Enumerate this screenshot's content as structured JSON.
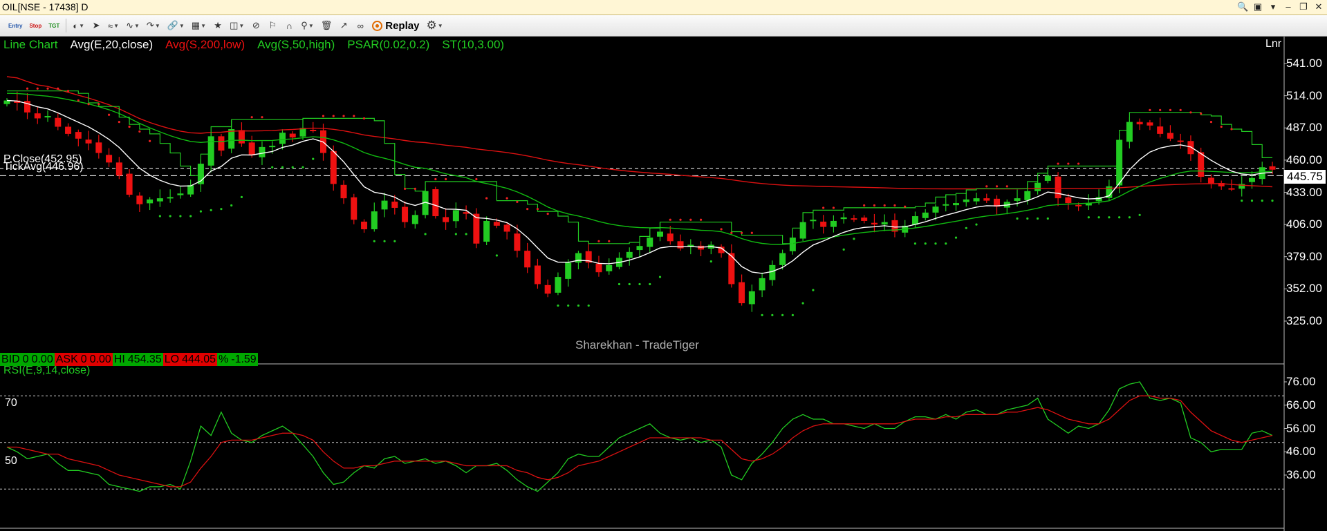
{
  "window": {
    "title": "OIL[NSE - 17438] D"
  },
  "toolbar": {
    "entry_label": "Entry",
    "stop_label": "Stop",
    "tgt_label": "TGT",
    "replay_label": "Replay"
  },
  "legend": {
    "chart_type": "Line Chart",
    "ema20": "Avg(E,20,close)",
    "sma200": "Avg(S,200,low)",
    "sma50": "Avg(S,50,high)",
    "psar": "PSAR(0.02,0.2)",
    "supertrend": "ST(10,3.00)",
    "scale_mode": "Lnr"
  },
  "colors": {
    "background": "#000000",
    "up_candle": "#22cc22",
    "down_candle": "#ee1111",
    "ema": "#ffffff",
    "sma200": "#dd1111",
    "sma50": "#11bb11",
    "psar": "#ee2222",
    "rsi": "#22cc22",
    "rsi_signal": "#dd1111"
  },
  "watermark": "Sharekhan - TradeTiger",
  "price_labels": {
    "prev_close": "P.Close(452.95)",
    "tick_avg": "TickAvg(446.96)",
    "current_price": "445.75"
  },
  "quote_bar": {
    "bid_label": "BID",
    "bid_qty": "0",
    "bid_price": "0.00",
    "ask_label": "ASK",
    "ask_qty": "0",
    "ask_price": "0.00",
    "hi_label": "HI",
    "hi_value": "454.35",
    "lo_label": "LO",
    "lo_value": "444.05",
    "pct_label": "%",
    "pct_value": "-1.59"
  },
  "rsi_panel": {
    "label": "RSI(E,9,14,close)",
    "level_70": "70",
    "level_50": "50"
  },
  "chart_data": [
    {
      "type": "candlestick",
      "price_axis_ticks": [
        "541.00",
        "514.00",
        "487.00",
        "460.00",
        "433.00",
        "406.00",
        "379.00",
        "352.00",
        "325.00"
      ],
      "price_axis_values": [
        541,
        514,
        487,
        460,
        433,
        406,
        379,
        352,
        325
      ],
      "ylim": [
        297,
        560
      ],
      "prev_close": 452.95,
      "tick_avg": 446.96,
      "last_price": 445.75,
      "closes": [
        510,
        508,
        500,
        495,
        497,
        488,
        482,
        478,
        474,
        466,
        458,
        447,
        431,
        423,
        427,
        428,
        429,
        432,
        439,
        457,
        480,
        468,
        486,
        474,
        464,
        471,
        472,
        483,
        479,
        487,
        485,
        466,
        440,
        428,
        410,
        402,
        417,
        426,
        420,
        408,
        414,
        434,
        413,
        408,
        418,
        415,
        390,
        409,
        405,
        400,
        384,
        370,
        356,
        348,
        362,
        374,
        382,
        374,
        366,
        372,
        378,
        383,
        388,
        395,
        400,
        392,
        386,
        389,
        385,
        389,
        382,
        356,
        340,
        350,
        361,
        372,
        382,
        395,
        408,
        410,
        404,
        409,
        412,
        411,
        409,
        406,
        408,
        400,
        405,
        413,
        416,
        421,
        423,
        424,
        427,
        428,
        426,
        421,
        425,
        428,
        434,
        441,
        447,
        428,
        424,
        422,
        424,
        429,
        438,
        477,
        492,
        490,
        489,
        482,
        478,
        476,
        465,
        446,
        440,
        438,
        436,
        440,
        445,
        454,
        452
      ]
    },
    {
      "type": "line",
      "title": "RSI(E,9,14,close)",
      "axis_ticks": [
        "76.00",
        "66.00",
        "56.00",
        "46.00",
        "36.00"
      ],
      "axis_values": [
        76,
        66,
        56,
        46,
        36
      ],
      "ylim": [
        31,
        80
      ],
      "levels": [
        70,
        50,
        30
      ],
      "series": [
        {
          "name": "RSI",
          "values": [
            48,
            46,
            43,
            44,
            45,
            41,
            38,
            38,
            37,
            36,
            32,
            31,
            30,
            29,
            31,
            31,
            32,
            30,
            42,
            57,
            53,
            63,
            54,
            51,
            50,
            53,
            55,
            57,
            54,
            49,
            44,
            37,
            32,
            33,
            37,
            40,
            39,
            43,
            44,
            41,
            42,
            43,
            41,
            42,
            40,
            37,
            40,
            40,
            41,
            38,
            34,
            31,
            29,
            33,
            37,
            43,
            45,
            44,
            44,
            48,
            52,
            54,
            56,
            58,
            54,
            52,
            51,
            52,
            50,
            51,
            48,
            36,
            34,
            41,
            45,
            50,
            56,
            60,
            62,
            60,
            60,
            58,
            58,
            57,
            56,
            58,
            56,
            56,
            59,
            61,
            61,
            60,
            62,
            60,
            63,
            64,
            62,
            62,
            64,
            65,
            66,
            69,
            60,
            57,
            54,
            57,
            56,
            58,
            64,
            73,
            75,
            76,
            69,
            68,
            69,
            67,
            52,
            50,
            46,
            47,
            47,
            47,
            54,
            55,
            53
          ]
        },
        {
          "name": "Signal",
          "values": [
            48,
            48,
            47,
            46,
            45,
            45,
            43,
            42,
            41,
            40,
            38,
            36,
            35,
            34,
            33,
            32,
            31,
            31,
            33,
            39,
            44,
            50,
            51,
            51,
            51,
            52,
            53,
            54,
            54,
            53,
            51,
            46,
            42,
            39,
            39,
            40,
            40,
            41,
            42,
            42,
            42,
            42,
            42,
            42,
            41,
            40,
            40,
            40,
            40,
            40,
            38,
            37,
            35,
            34,
            35,
            37,
            40,
            41,
            42,
            44,
            46,
            48,
            50,
            52,
            52,
            52,
            52,
            52,
            52,
            51,
            51,
            47,
            43,
            42,
            43,
            45,
            48,
            52,
            55,
            57,
            58,
            58,
            58,
            58,
            58,
            58,
            58,
            58,
            59,
            60,
            60,
            60,
            61,
            61,
            62,
            62,
            62,
            62,
            63,
            63,
            64,
            65,
            64,
            62,
            60,
            59,
            58,
            58,
            60,
            64,
            68,
            70,
            70,
            69,
            69,
            68,
            63,
            59,
            55,
            53,
            51,
            50,
            51,
            52,
            53
          ]
        }
      ]
    }
  ]
}
